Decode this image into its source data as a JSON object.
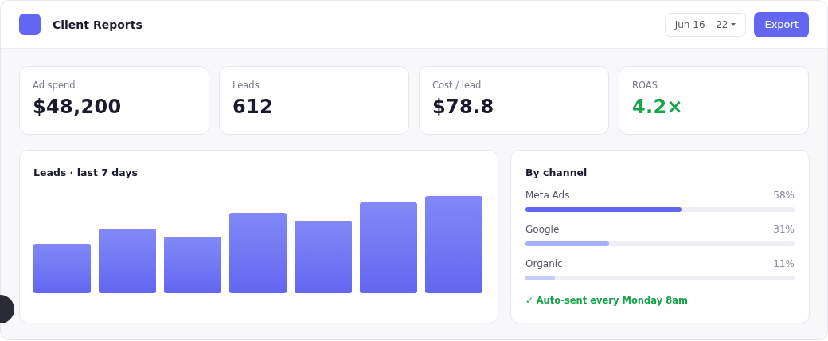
{
  "header": {
    "title": "Client Reports",
    "date_range": "Jun 16 – 22",
    "export_button": "Export"
  },
  "kpis": [
    {
      "label": "Ad spend",
      "value": "$48,200",
      "kind": "plain"
    },
    {
      "label": "Leads",
      "value": "612",
      "kind": "plain"
    },
    {
      "label": "Cost / lead",
      "value": "$78.8",
      "kind": "plain"
    },
    {
      "label": "ROAS",
      "value": "4.2×",
      "kind": "positive"
    }
  ],
  "leads_chart": {
    "title": "Leads · last 7 days"
  },
  "by_channel": {
    "title": "By channel",
    "channels": [
      {
        "name": "Meta Ads",
        "reading": "58%",
        "level": 0.58,
        "color": "#6366f1"
      },
      {
        "name": "Google",
        "reading": "31%",
        "level": 0.31,
        "color": "#a5b0f8"
      },
      {
        "name": "Organic",
        "reading": "11%",
        "level": 0.11,
        "color": "#c7cdfa"
      }
    ],
    "note": "✓ Auto-sent every Monday 8am"
  }
}
